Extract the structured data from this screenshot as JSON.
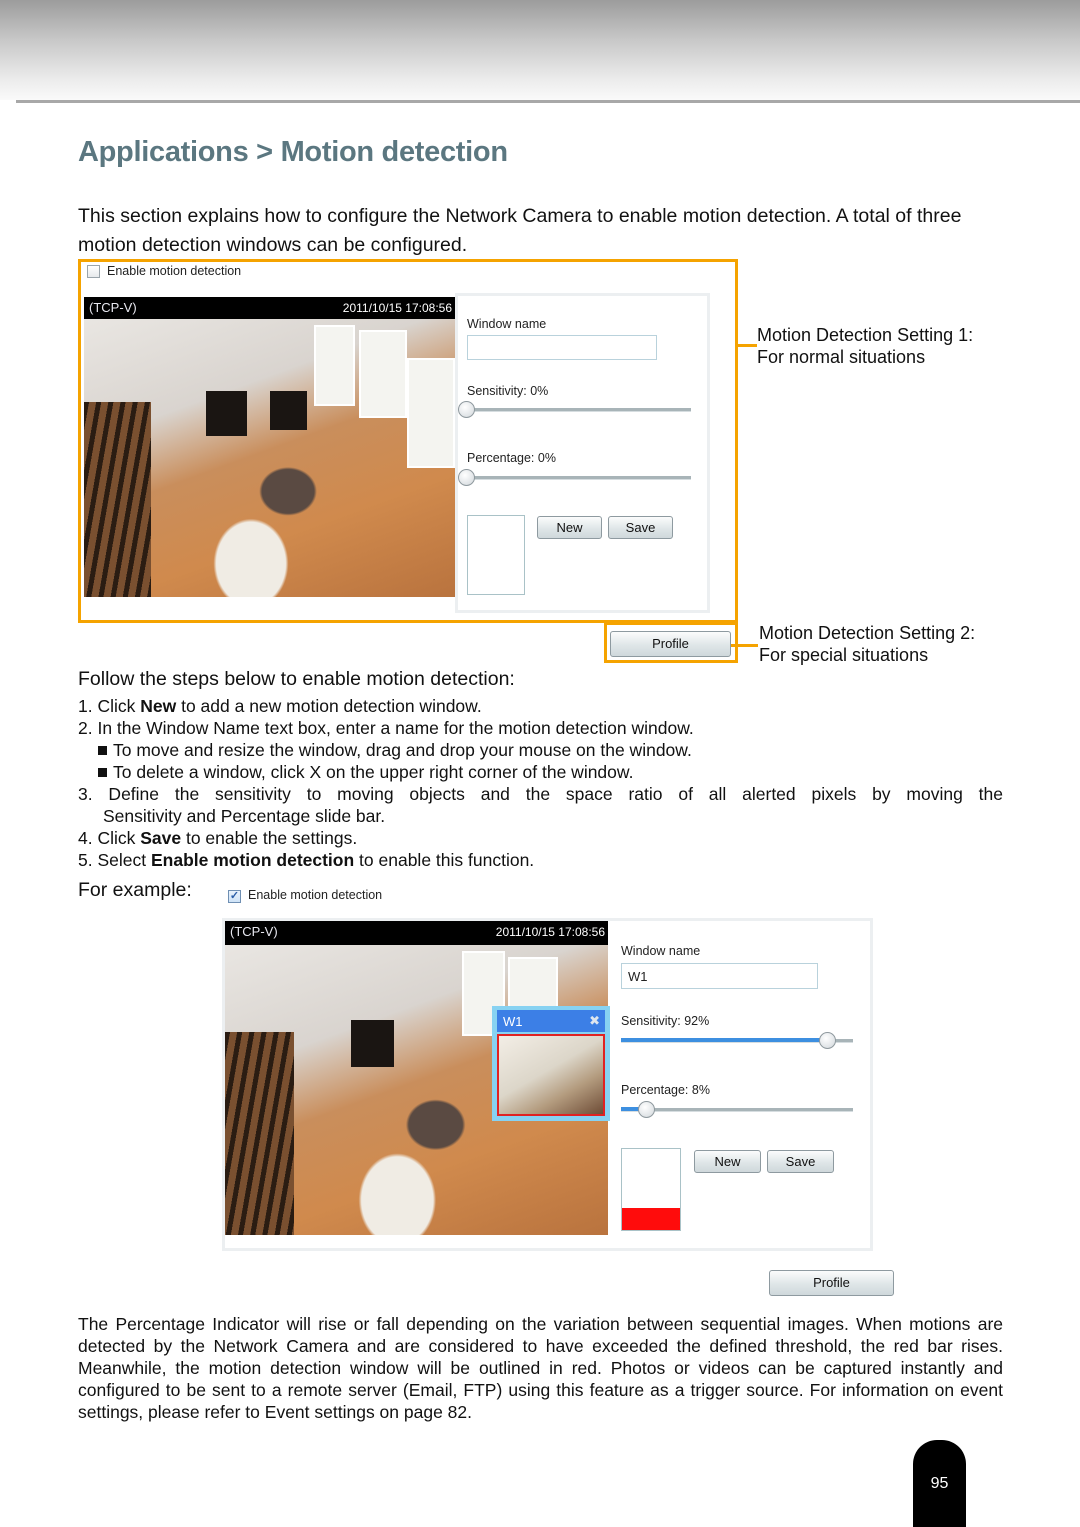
{
  "page": {
    "title": "Applications > Motion detection",
    "intro": "This section explains how to configure the Network Camera to enable motion detection. A total of three motion detection windows can be configured.",
    "page_number": "95",
    "accent_color": "#f5a300",
    "title_color": "#5b7780"
  },
  "figure1": {
    "enable_checkbox": {
      "label": "Enable motion detection",
      "checked": false
    },
    "camera": {
      "source_label": "(TCP-V)",
      "timestamp": "2011/10/15  17:08:56"
    },
    "settings": {
      "window_name_label": "Window name",
      "window_name_value": "",
      "sensitivity_label": "Sensitivity: 0%",
      "sensitivity_value": 0,
      "percentage_label": "Percentage: 0%",
      "percentage_value": 0,
      "indicator_level": 0,
      "new_button": "New",
      "save_button": "Save"
    },
    "profile_button": "Profile",
    "callout1": {
      "line1": "Motion Detection Setting 1:",
      "line2": "For normal situations"
    },
    "callout2": {
      "line1": "Motion Detection Setting 2:",
      "line2": "For special situations"
    }
  },
  "steps": {
    "heading": "Follow the steps below to enable motion detection:",
    "step1": {
      "prefix": "1. Click ",
      "bold": "New",
      "suffix": " to add a new motion detection window."
    },
    "step2": "2. In the Window Name text box, enter a name for the motion detection window.",
    "step2_bullets": [
      "To move and resize the window, drag and drop your mouse on the window.",
      "To delete a window, click X on the upper right corner of the window."
    ],
    "step3_line1": "3. Define the sensitivity to moving objects and the space ratio of all alerted pixels by moving the",
    "step3_line2": "Sensitivity and Percentage slide bar.",
    "step4": {
      "prefix": "4. Click ",
      "bold": "Save",
      "suffix": " to enable the settings."
    },
    "step5": {
      "prefix": "5. Select ",
      "bold": "Enable motion detection",
      "suffix": " to enable this function."
    },
    "example_label": "For example:"
  },
  "figure2": {
    "enable_checkbox": {
      "label": "Enable motion detection",
      "checked": true
    },
    "camera": {
      "source_label": "(TCP-V)",
      "timestamp": "2011/10/15  17:08:56"
    },
    "motion_window": {
      "name": "W1",
      "close_glyph": "✖"
    },
    "settings": {
      "window_name_label": "Window name",
      "window_name_value": "W1",
      "sensitivity_label": "Sensitivity: 92%",
      "sensitivity_value": 92,
      "percentage_label": "Percentage: 8%",
      "percentage_value": 8,
      "indicator_level": 27,
      "new_button": "New",
      "save_button": "Save"
    },
    "profile_button": "Profile"
  },
  "closing_paragraph": "The Percentage Indicator will rise or fall depending on the variation between sequential images. When motions are detected by the Network Camera and are considered to have exceeded the defined threshold, the red bar rises. Meanwhile, the motion detection window will be outlined in red. Photos or videos can be captured instantly and configured to be sent to a remote server (Email, FTP) using this feature as a trigger source. For information on event settings, please refer to Event settings on page 82."
}
